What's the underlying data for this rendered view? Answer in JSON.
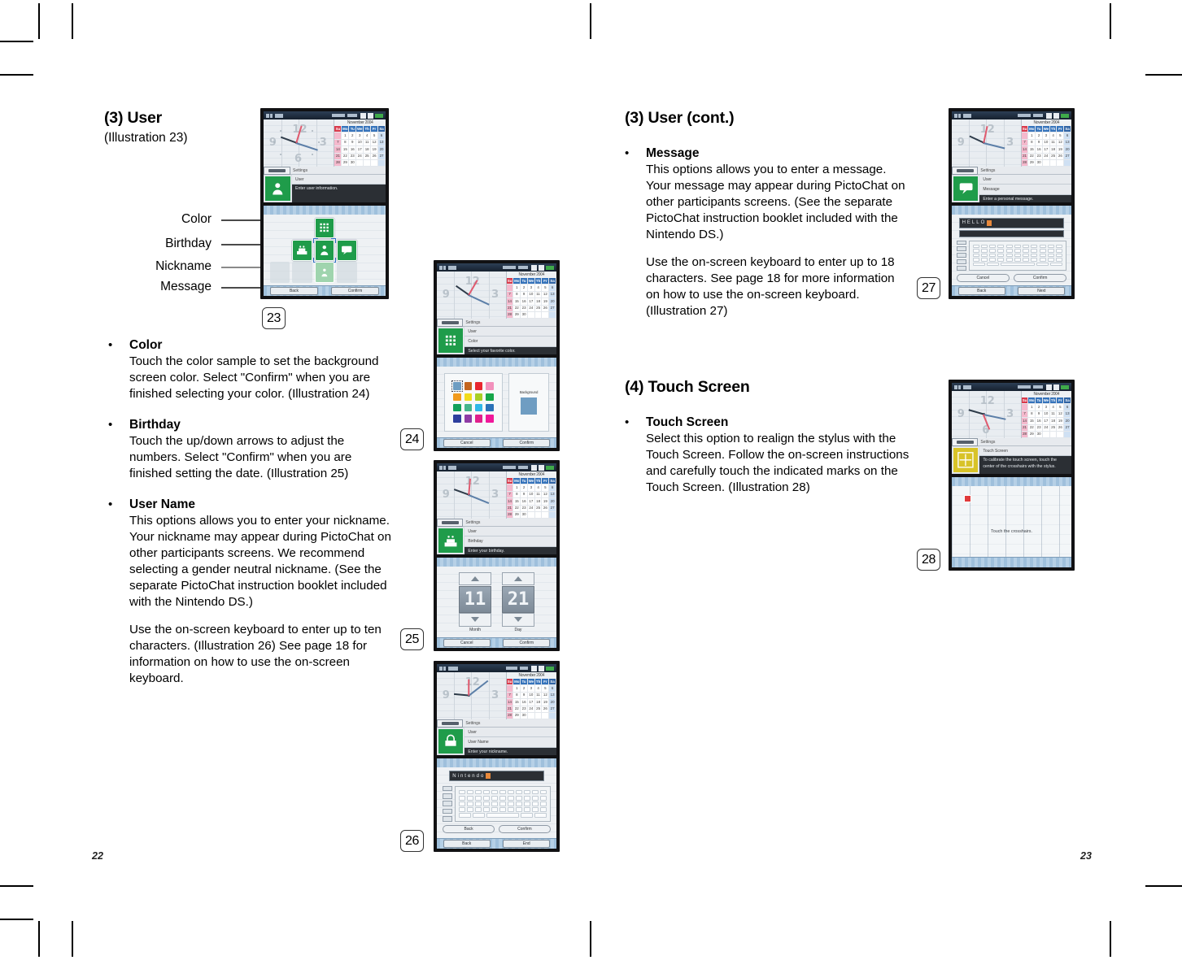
{
  "document": {
    "left_page_number": "22",
    "right_page_number": "23"
  },
  "left_column": {
    "heading": "(3) User",
    "subheading": "(Illustration 23)",
    "callouts": [
      {
        "label": "Color"
      },
      {
        "label": "Birthday"
      },
      {
        "label": "Nickname"
      },
      {
        "label": "Message"
      }
    ],
    "bullets": [
      {
        "title": "Color",
        "paragraphs": [
          "Touch the color sample to set the background screen color. Select \"Confirm\" when you are finished selecting your color. (Illustration 24)"
        ]
      },
      {
        "title": "Birthday",
        "paragraphs": [
          "Touch the up/down arrows to adjust the numbers. Select \"Confirm\" when you are finished setting the date. (Illustration 25)"
        ]
      },
      {
        "title": "User Name",
        "paragraphs": [
          "This options allows you to enter your nickname. Your nickname may appear during PictoChat on other participants screens. We recommend selecting a gender neutral nickname. (See the separate PictoChat instruction booklet included with the Nintendo DS.)",
          "Use the on-screen keyboard to enter up to ten characters. (Illustration 26) See page 18 for information on how to use the on-screen keyboard."
        ]
      }
    ]
  },
  "right_column": {
    "heading": "(3) User (cont.)",
    "bullets": [
      {
        "title": "Message",
        "paragraphs": [
          "This options allows you to enter a message. Your message may appear during PictoChat on other participants screens. (See the separate PictoChat instruction booklet included with the Nintendo DS.)",
          "Use the on-screen keyboard to enter up to 18 characters. See page 18 for more information on how to use the on-screen keyboard. (Illustration 27)"
        ]
      }
    ],
    "heading2": "(4) Touch Screen",
    "bullets2": [
      {
        "title": "Touch Screen",
        "paragraphs": [
          "Select this option to realign the stylus with the Touch Screen. Follow the on-screen instructions and carefully touch the indicated marks on the Touch Screen. (Illustration 28)"
        ]
      }
    ]
  },
  "illustrations": [
    {
      "badge": "23",
      "type": "icon-grid",
      "top_screen": {
        "clock_numerals": [
          "12",
          "3",
          "6",
          "9"
        ],
        "calendar_month": "November 2004",
        "calendar_headers": [
          "Su",
          "Mo",
          "Tu",
          "We",
          "Th",
          "Fr",
          "Sa"
        ],
        "settings_crumb": "Settings",
        "settings_line1": "User",
        "settings_line2": "",
        "settings_desc": "Enter user information."
      },
      "bottom_screen": {
        "buttons": [
          "Back",
          "Confirm"
        ]
      }
    },
    {
      "badge": "24",
      "type": "palette",
      "top_screen": {
        "calendar_month": "November 2004",
        "settings_crumb": "Settings",
        "settings_line1": "User",
        "settings_line2": "Color",
        "settings_desc": "Select your favorite color."
      },
      "bottom_screen": {
        "preview_label": "Background",
        "buttons": [
          "Cancel",
          "Confirm"
        ],
        "colors": [
          "#6f9dc2",
          "#c4651f",
          "#e8262f",
          "#f291bc",
          "#f19a1e",
          "#f1dc1c",
          "#a8cf25",
          "#16a64a",
          "#12a05a",
          "#44b58c",
          "#2fb8e8",
          "#2b72b8",
          "#2e3f9e",
          "#8e3ba5",
          "#e0208c",
          "#f0189a"
        ],
        "selected_index": 0
      }
    },
    {
      "badge": "25",
      "type": "spinner",
      "top_screen": {
        "calendar_month": "November 2004",
        "settings_crumb": "Settings",
        "settings_line1": "User",
        "settings_line2": "Birthday",
        "settings_desc": "Enter your birthday."
      },
      "bottom_screen": {
        "month_value": "11",
        "day_value": "21",
        "month_caption": "Month",
        "day_caption": "Day",
        "buttons": [
          "Cancel",
          "Confirm"
        ]
      }
    },
    {
      "badge": "26",
      "type": "keyboard",
      "top_screen": {
        "calendar_month": "November 2004",
        "settings_crumb": "Settings",
        "settings_line1": "User",
        "settings_line2": "User Name",
        "settings_desc": "Enter your nickname."
      },
      "bottom_screen": {
        "field_text": "Nintendo",
        "actions": [
          "Back",
          "Confirm"
        ],
        "buttons": [
          "Back",
          "End"
        ]
      }
    },
    {
      "badge": "27",
      "type": "keyboard-message",
      "top_screen": {
        "calendar_month": "November 2004",
        "settings_crumb": "Settings",
        "settings_line1": "User",
        "settings_line2": "Message",
        "settings_desc": "Enter a personal message."
      },
      "bottom_screen": {
        "field_text": "HELLO",
        "actions": [
          "Cancel",
          "Confirm"
        ],
        "buttons": [
          "Back",
          "Next"
        ]
      }
    },
    {
      "badge": "28",
      "type": "calibration",
      "top_screen": {
        "calendar_month": "November 2004",
        "settings_crumb": "Settings",
        "settings_line1": "Touch Screen",
        "settings_desc": "To calibrate the touch screen, touch the center of the crosshairs with the stylus."
      },
      "bottom_screen": {
        "message": "Touch the crosshairs."
      }
    }
  ],
  "calendar_rows": [
    [
      "",
      "1",
      "2",
      "3",
      "4",
      "5",
      "6"
    ],
    [
      "7",
      "8",
      "9",
      "10",
      "11",
      "12",
      "13"
    ],
    [
      "14",
      "15",
      "16",
      "17",
      "18",
      "19",
      "20"
    ],
    [
      "21",
      "22",
      "23",
      "24",
      "25",
      "26",
      "27"
    ],
    [
      "28",
      "29",
      "30",
      "",
      "",
      "",
      ""
    ]
  ]
}
